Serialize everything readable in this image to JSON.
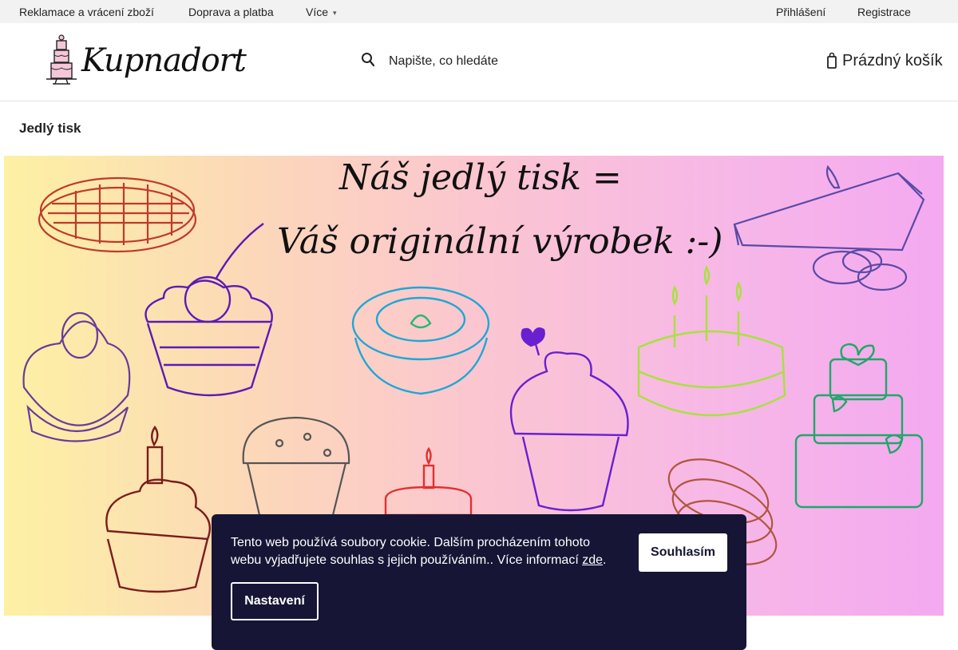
{
  "topbar": {
    "links": [
      "Reklamace a vrácení zboží",
      "Doprava a platba",
      "Více"
    ],
    "login": "Přihlášení",
    "register": "Registrace"
  },
  "header": {
    "logo_text": "Kupnadort",
    "search_placeholder": "Napište, co hledáte",
    "cart_label": "Prázdný košík"
  },
  "page": {
    "title": "Jedlý tisk"
  },
  "banner": {
    "line1": "Náš jedlý tisk =",
    "line2": "Váš originální výrobek :-)"
  },
  "cookie": {
    "text": "Tento web používá soubory cookie. Dalším procházením tohoto webu vyjadřujete souhlas s jejich používáním.. Více informací ",
    "link": "zde",
    "after": ".",
    "agree": "Souhlasím",
    "settings": "Nastavení"
  },
  "colors": {
    "cookie_bg": "#161535",
    "topbar_bg": "#f2f2f2",
    "banner_left": "#fdf1a4",
    "banner_right": "#f4a9f0"
  },
  "icons": [
    "chevron-down-icon",
    "search-icon",
    "cart-icon",
    "cake-logo-icon"
  ]
}
